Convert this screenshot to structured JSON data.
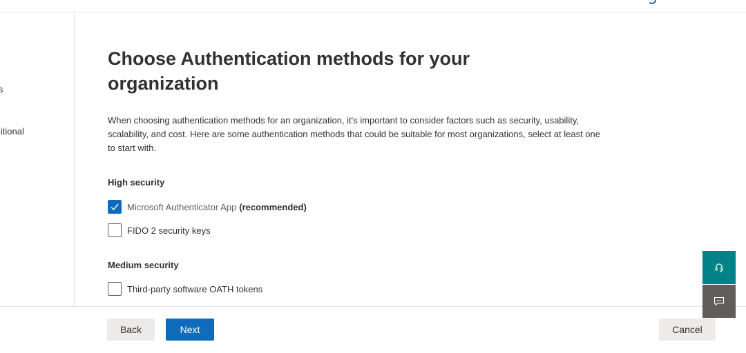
{
  "nav": {
    "frag1": "s",
    "frag2": "litional"
  },
  "main": {
    "title": "Choose Authentication methods for your organization",
    "description": "When choosing authentication methods for an organization, it's important to consider factors such as security, usability, scalability, and cost. Here are some authentication methods that could be suitable for most organizations, select at least one to start with.",
    "sections": [
      {
        "heading": "High security",
        "options": [
          {
            "label": "Microsoft Authenticator App",
            "suffix": "(recommended)",
            "checked": true
          },
          {
            "label": "FIDO 2 security keys",
            "checked": false
          }
        ]
      },
      {
        "heading": "Medium security",
        "options": [
          {
            "label": "Third-party software OATH tokens",
            "checked": false
          }
        ]
      }
    ]
  },
  "footer": {
    "back_label": "Back",
    "next_label": "Next",
    "cancel_label": "Cancel"
  },
  "side_buttons": {
    "help_icon": "headset-icon",
    "feedback_icon": "feedback-icon",
    "help_color": "#038387",
    "feedback_color": "#605e5c"
  },
  "colors": {
    "accent": "#0f6cbd"
  }
}
